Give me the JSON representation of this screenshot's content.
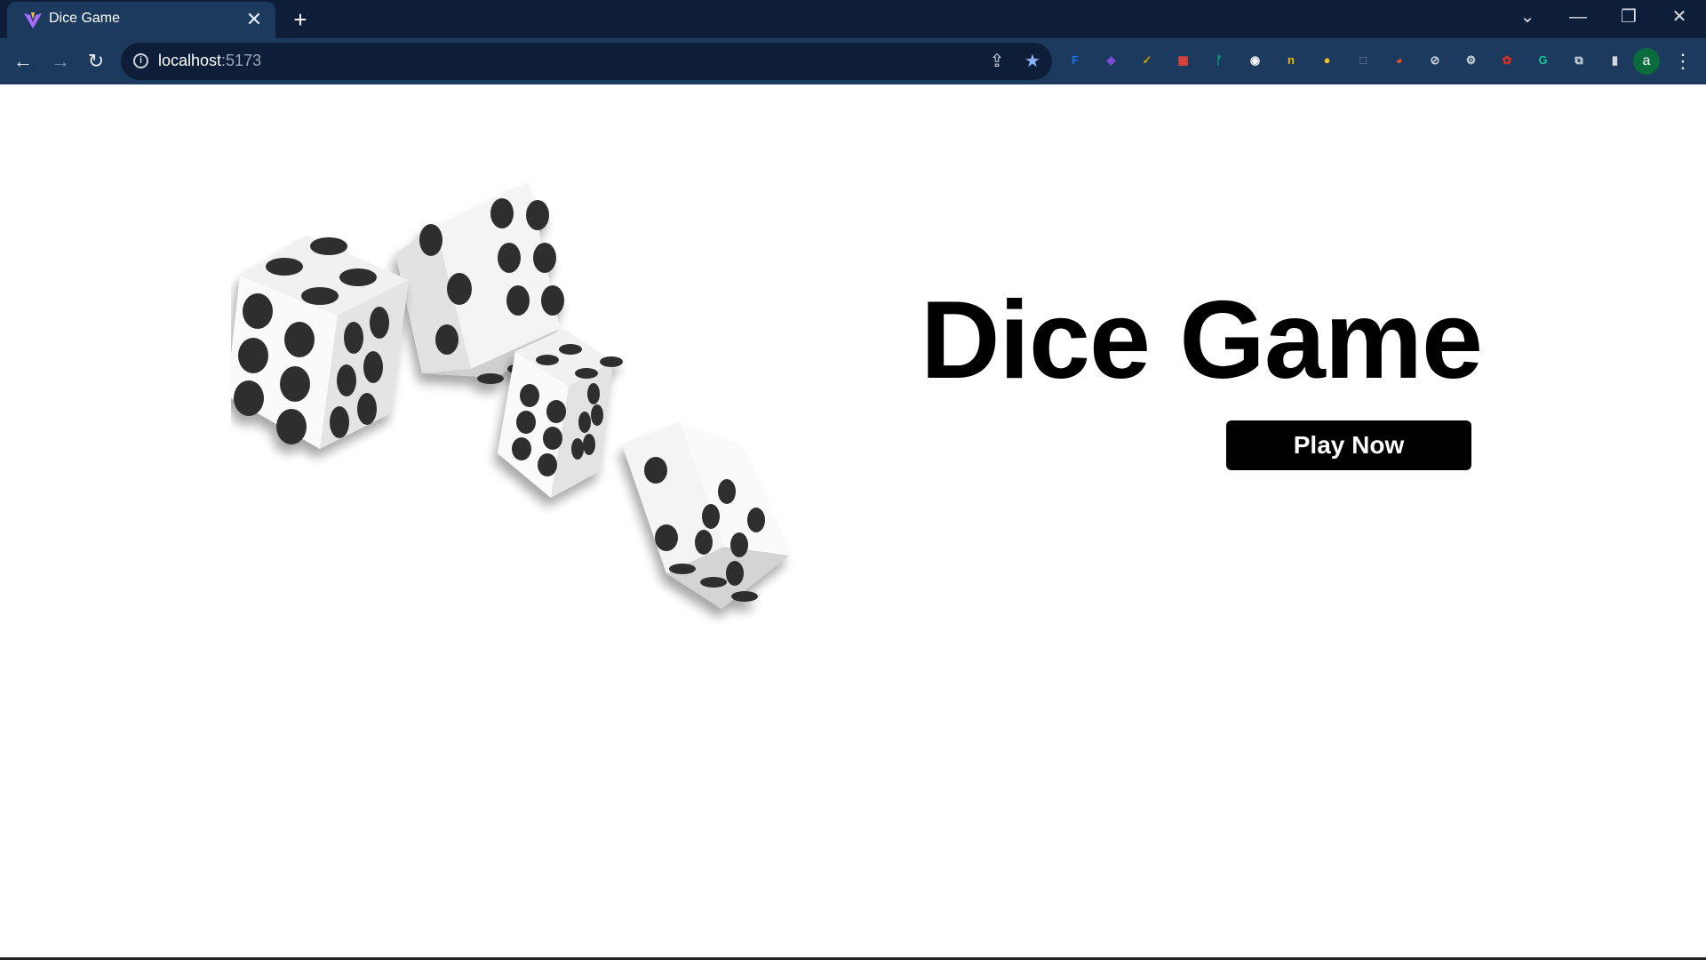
{
  "browser": {
    "tab": {
      "title": "Dice Game",
      "favicon": "vite-logo-icon",
      "close_glyph": "✕"
    },
    "new_tab_glyph": "+",
    "window_controls": {
      "tab_search": "⌄",
      "minimize": "—",
      "restore": "❐",
      "close": "✕"
    },
    "nav": {
      "back": "←",
      "forward": "→",
      "reload": "↻"
    },
    "address": {
      "host": "localhost",
      "port": ":5173"
    },
    "omnibox_icons": {
      "share": "⇪",
      "bookmark": "★"
    },
    "extensions": [
      {
        "name": "extension-icon",
        "glyph": "F",
        "color": "#1a73e8"
      },
      {
        "name": "extension-icon",
        "glyph": "◆",
        "color": "#7b4dd6"
      },
      {
        "name": "extension-icon",
        "glyph": "✓",
        "color": "#c9a000"
      },
      {
        "name": "extension-icon",
        "glyph": "▦",
        "color": "#e94235"
      },
      {
        "name": "extension-icon",
        "glyph": "ᚠ",
        "color": "#0aa37f"
      },
      {
        "name": "extension-icon",
        "glyph": "◉",
        "color": "#ffffff"
      },
      {
        "name": "extension-icon",
        "glyph": "n",
        "color": "#f2b600"
      },
      {
        "name": "extension-icon",
        "glyph": "●",
        "color": "#f6c026"
      },
      {
        "name": "extension-icon",
        "glyph": "□",
        "color": "#7d8aa3"
      },
      {
        "name": "extension-icon",
        "glyph": "◕",
        "color": "#e8562a"
      },
      {
        "name": "extension-icon",
        "glyph": "⊘",
        "color": "#d4d9e2"
      },
      {
        "name": "gear-icon",
        "glyph": "⚙",
        "color": "#d4d9e2"
      },
      {
        "name": "extension-icon",
        "glyph": "✿",
        "color": "#d93025"
      },
      {
        "name": "grammarly-icon",
        "glyph": "G",
        "color": "#15c39a"
      },
      {
        "name": "puzzle-icon",
        "glyph": "⧉",
        "color": "#d4d9e2"
      },
      {
        "name": "side-panel-icon",
        "glyph": "▮",
        "color": "#d4d9e2"
      }
    ],
    "profile_initial": "a",
    "menu_glyph": "⋮"
  },
  "page": {
    "title": "Dice Game",
    "play_button": "Play Now"
  }
}
